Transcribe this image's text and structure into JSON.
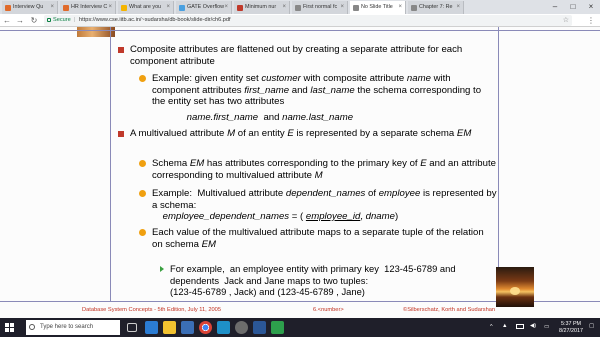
{
  "browser": {
    "tabs": [
      {
        "label": "Interview Qu",
        "color": "#e06a2a",
        "active": false
      },
      {
        "label": "HR Interview C",
        "color": "#e06a2a",
        "active": false
      },
      {
        "label": "What are you",
        "color": "#f5b400",
        "active": false
      },
      {
        "label": "GATE Overflow",
        "color": "#4aa0e0",
        "active": false
      },
      {
        "label": "Minimum nur",
        "color": "#c0392b",
        "active": false
      },
      {
        "label": "First normal fc",
        "color": "#888888",
        "active": false
      },
      {
        "label": "No Slide Title",
        "color": "#888888",
        "active": true
      },
      {
        "label": "Chapter 7: Re",
        "color": "#888888",
        "active": false
      }
    ],
    "address": {
      "secure_label": "Secure",
      "url": "https://www.cse.iitb.ac.in/~sudarsha/db-book/slide-dir/ch6.pdf"
    }
  },
  "slide": {
    "bullets": [
      {
        "level": 1,
        "text_html": "Composite attributes are flattened out by creating a separate attribute for each component attribute"
      },
      {
        "level": 2,
        "text_html": "Example: given entity set <i>customer</i> with composite attribute <i>name</i> with component attributes <i>first_name</i> and <i>last_name</i> the schema corresponding to the entity set has two attributes"
      },
      {
        "level": 2,
        "text_html": "&nbsp;&nbsp;&nbsp;&nbsp;&nbsp;&nbsp;&nbsp;&nbsp;&nbsp;&nbsp;&nbsp;&nbsp;&nbsp;<i>name.first_name</i> &nbsp;and <i>name.last_name</i>",
        "continuation": true
      },
      {
        "level": 1,
        "text_html": "A multivalued attribute <i>M</i> of an entity <i>E</i> is represented by a separate schema <i>EM</i>"
      },
      {
        "level": 2,
        "text_html": "Schema <i>EM</i> has attributes corresponding to the primary key of <i>E</i> and an attribute corresponding to multivalued attribute <i>M</i>"
      },
      {
        "level": 2,
        "text_html": "Example: &nbsp;Multivalued attribute <i>dependent_names</i> of <i>employee</i> is represented by a schema:<br>&nbsp;&nbsp;&nbsp;&nbsp;<i>employee_dependent_names</i> = ( <i><u>employee_id</u></i>, <i>dname</i>)"
      },
      {
        "level": 2,
        "text_html": "Each value of the multivalued attribute maps to a separate tuple of the relation on schema <i>EM</i>"
      },
      {
        "level": 3,
        "text_html": "For example, &nbsp;an employee entity with primary key &nbsp;123-45-6789 and dependents &nbsp;Jack and Jane maps to two tuples:<br>(123-45-6789 , Jack) and (123-45-6789 , Jane)"
      }
    ],
    "footer": {
      "left": "Database System Concepts - 5th Edition, July 11, 2005",
      "center": "6.<number>",
      "right": "©Silberschatz, Korth and Sudarshan"
    }
  },
  "taskbar": {
    "search_placeholder": "Type here to search",
    "time": "5:37 PM",
    "date": "8/27/2017"
  }
}
